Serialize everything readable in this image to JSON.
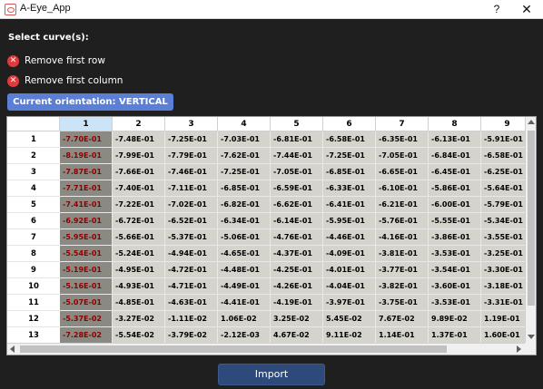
{
  "window": {
    "title": "A-Eye_App",
    "help_label": "?",
    "close_label": "✕"
  },
  "select_label": "Select curve(s):",
  "options": [
    {
      "label": "Remove first row",
      "icon": "x-circle-icon",
      "color": "#e03a3a"
    },
    {
      "label": "Remove first column",
      "icon": "x-circle-icon",
      "color": "#e03a3a"
    }
  ],
  "orientation_button": "Current orientation: VERTICAL",
  "import_button": "Import",
  "table": {
    "columns": [
      "1",
      "2",
      "3",
      "4",
      "5",
      "6",
      "7",
      "8",
      "9"
    ],
    "selected_column": "1",
    "rows": [
      {
        "label": "1",
        "cells": [
          "-7.70E-01",
          "-7.48E-01",
          "-7.25E-01",
          "-7.03E-01",
          "-6.81E-01",
          "-6.58E-01",
          "-6.35E-01",
          "-6.13E-01",
          "-5.91E-01"
        ]
      },
      {
        "label": "2",
        "cells": [
          "-8.19E-01",
          "-7.99E-01",
          "-7.79E-01",
          "-7.62E-01",
          "-7.44E-01",
          "-7.25E-01",
          "-7.05E-01",
          "-6.84E-01",
          "-6.58E-01"
        ]
      },
      {
        "label": "3",
        "cells": [
          "-7.87E-01",
          "-7.66E-01",
          "-7.46E-01",
          "-7.25E-01",
          "-7.05E-01",
          "-6.85E-01",
          "-6.65E-01",
          "-6.45E-01",
          "-6.25E-01"
        ]
      },
      {
        "label": "4",
        "cells": [
          "-7.71E-01",
          "-7.40E-01",
          "-7.11E-01",
          "-6.85E-01",
          "-6.59E-01",
          "-6.33E-01",
          "-6.10E-01",
          "-5.86E-01",
          "-5.64E-01"
        ]
      },
      {
        "label": "5",
        "cells": [
          "-7.41E-01",
          "-7.22E-01",
          "-7.02E-01",
          "-6.82E-01",
          "-6.62E-01",
          "-6.41E-01",
          "-6.21E-01",
          "-6.00E-01",
          "-5.79E-01"
        ]
      },
      {
        "label": "6",
        "cells": [
          "-6.92E-01",
          "-6.72E-01",
          "-6.52E-01",
          "-6.34E-01",
          "-6.14E-01",
          "-5.95E-01",
          "-5.76E-01",
          "-5.55E-01",
          "-5.34E-01"
        ]
      },
      {
        "label": "7",
        "cells": [
          "-5.95E-01",
          "-5.66E-01",
          "-5.37E-01",
          "-5.06E-01",
          "-4.76E-01",
          "-4.46E-01",
          "-4.16E-01",
          "-3.86E-01",
          "-3.55E-01"
        ]
      },
      {
        "label": "8",
        "cells": [
          "-5.54E-01",
          "-5.24E-01",
          "-4.94E-01",
          "-4.65E-01",
          "-4.37E-01",
          "-4.09E-01",
          "-3.81E-01",
          "-3.53E-01",
          "-3.25E-01"
        ]
      },
      {
        "label": "9",
        "cells": [
          "-5.19E-01",
          "-4.95E-01",
          "-4.72E-01",
          "-4.48E-01",
          "-4.25E-01",
          "-4.01E-01",
          "-3.77E-01",
          "-3.54E-01",
          "-3.30E-01"
        ]
      },
      {
        "label": "10",
        "cells": [
          "-5.16E-01",
          "-4.93E-01",
          "-4.71E-01",
          "-4.49E-01",
          "-4.26E-01",
          "-4.04E-01",
          "-3.82E-01",
          "-3.60E-01",
          "-3.18E-01"
        ]
      },
      {
        "label": "11",
        "cells": [
          "-5.07E-01",
          "-4.85E-01",
          "-4.63E-01",
          "-4.41E-01",
          "-4.19E-01",
          "-3.97E-01",
          "-3.75E-01",
          "-3.53E-01",
          "-3.31E-01"
        ]
      },
      {
        "label": "12",
        "cells": [
          "-5.37E-02",
          "-3.27E-02",
          "-1.11E-02",
          "1.06E-02",
          "3.25E-02",
          "5.45E-02",
          "7.67E-02",
          "9.89E-02",
          "1.19E-01"
        ]
      },
      {
        "label": "13",
        "cells": [
          "-7.28E-02",
          "-5.54E-02",
          "-3.79E-02",
          "-2.12E-03",
          "4.67E-02",
          "9.11E-02",
          "1.14E-01",
          "1.37E-01",
          "1.60E-01"
        ]
      }
    ]
  },
  "colors": {
    "accent_button": "#5b7fd6",
    "import_button": "#2d4a7a",
    "remove_icon": "#e03a3a",
    "first_column_text": "#8b0000"
  }
}
